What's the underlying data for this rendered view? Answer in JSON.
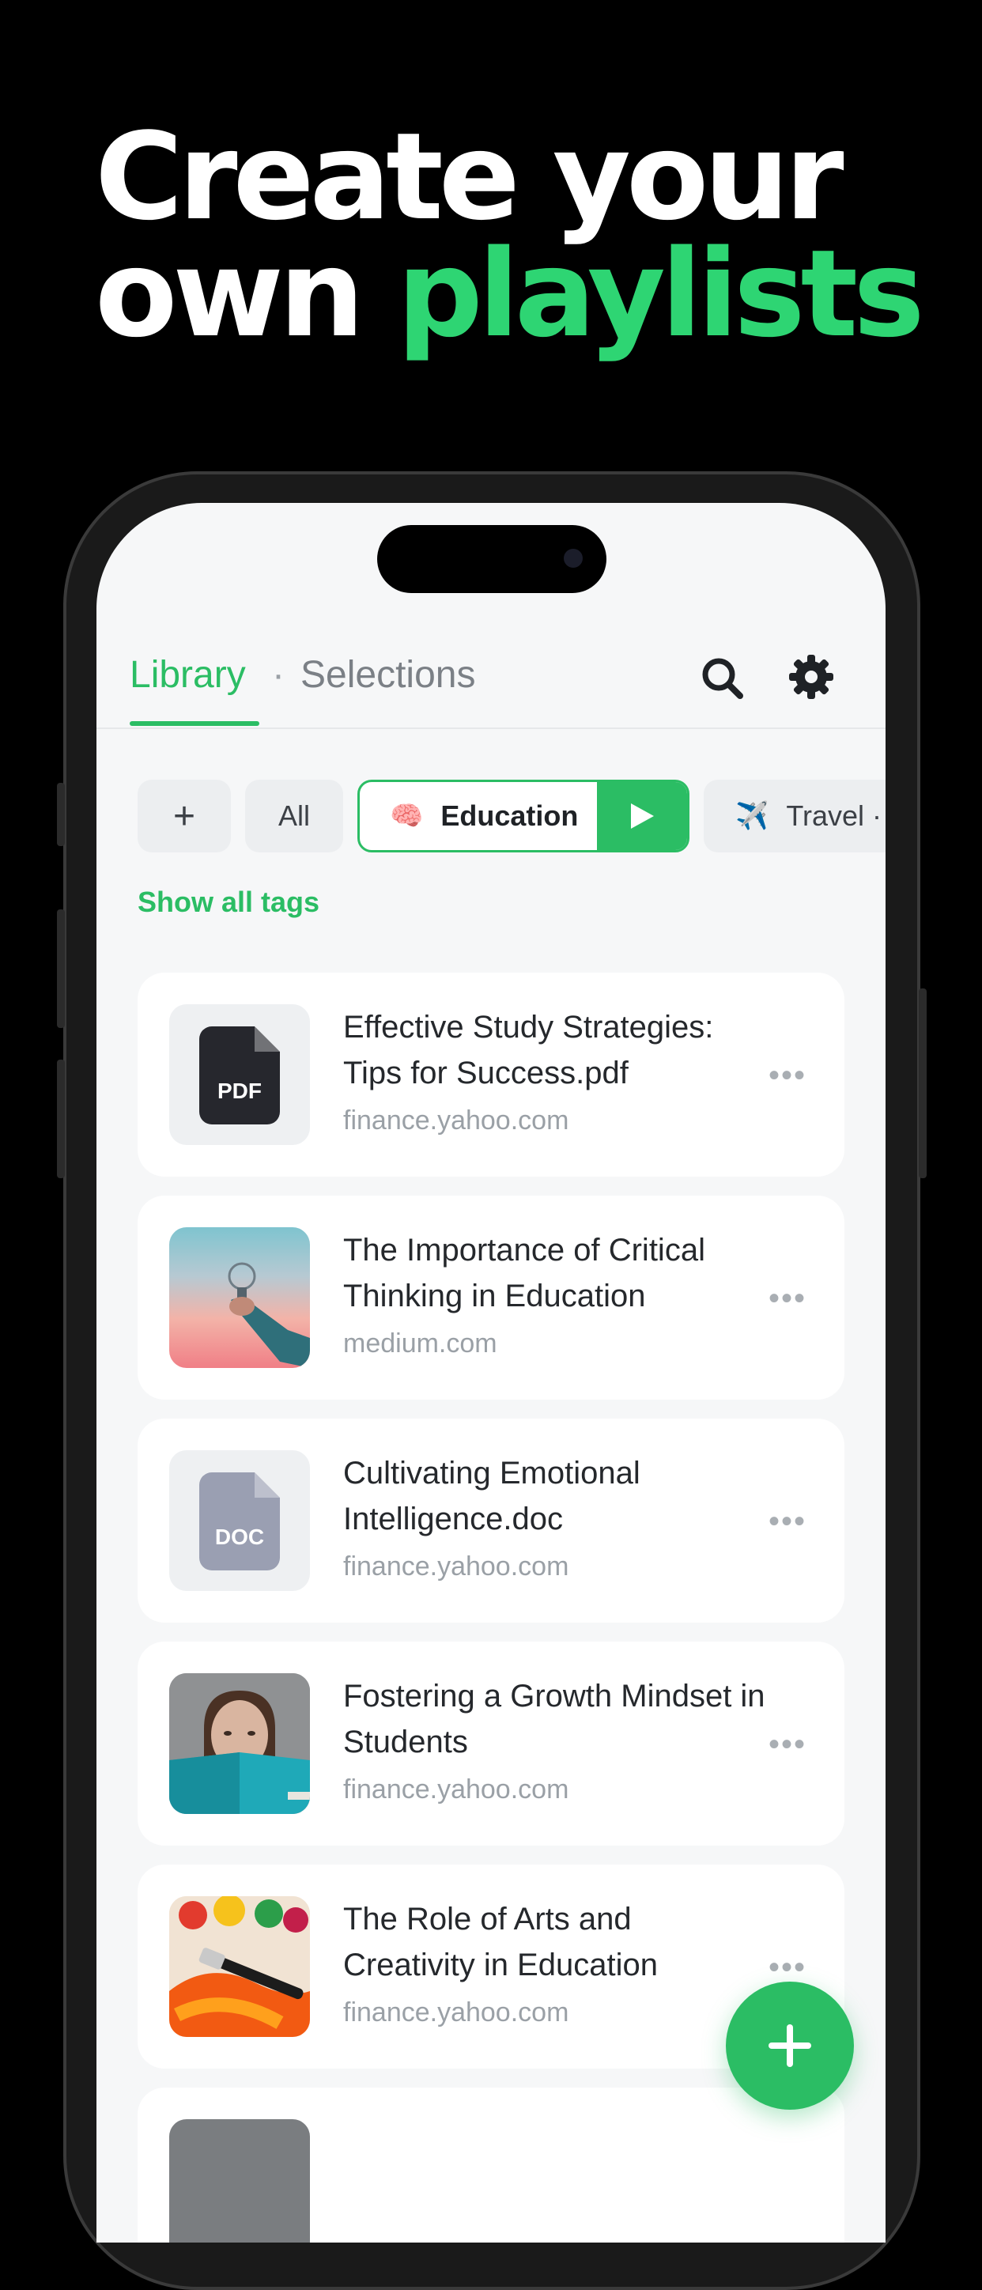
{
  "headline": {
    "line1": "Create your",
    "line2_plain": "own ",
    "line2_accent": "playlists"
  },
  "colors": {
    "accent": "#2bbd64",
    "headline_accent": "#2ed573",
    "background": "#000000",
    "screen": "#f6f7f8"
  },
  "header": {
    "tab_active": "Library",
    "separator": "·",
    "tab_inactive": "Selections",
    "icons": [
      "search-icon",
      "gear-icon"
    ]
  },
  "chips": {
    "add": "+",
    "all": "All",
    "education": {
      "emoji": "🧠",
      "label": "Education"
    },
    "travel": {
      "emoji": "✈️",
      "label": "Travel ·"
    }
  },
  "show_all_tags": "Show all tags",
  "items": [
    {
      "title": "Effective Study Strategies: Tips for Success.pdf",
      "domain": "finance.yahoo.com",
      "thumb": "pdf",
      "ext": "PDF"
    },
    {
      "title": "The Importance of Critical Thinking in Education",
      "domain": "medium.com",
      "thumb": "image-lightbulb"
    },
    {
      "title": "Cultivating Emotional Intelligence.doc",
      "domain": "finance.yahoo.com",
      "thumb": "doc",
      "ext": "DOC"
    },
    {
      "title": "Fostering a Growth Mindset in Students",
      "domain": "finance.yahoo.com",
      "thumb": "image-student"
    },
    {
      "title": "The Role of Arts and Creativity in Education",
      "domain": "finance.yahoo.com",
      "thumb": "image-paint"
    }
  ],
  "more_glyph": "•••",
  "fab_label": "+"
}
